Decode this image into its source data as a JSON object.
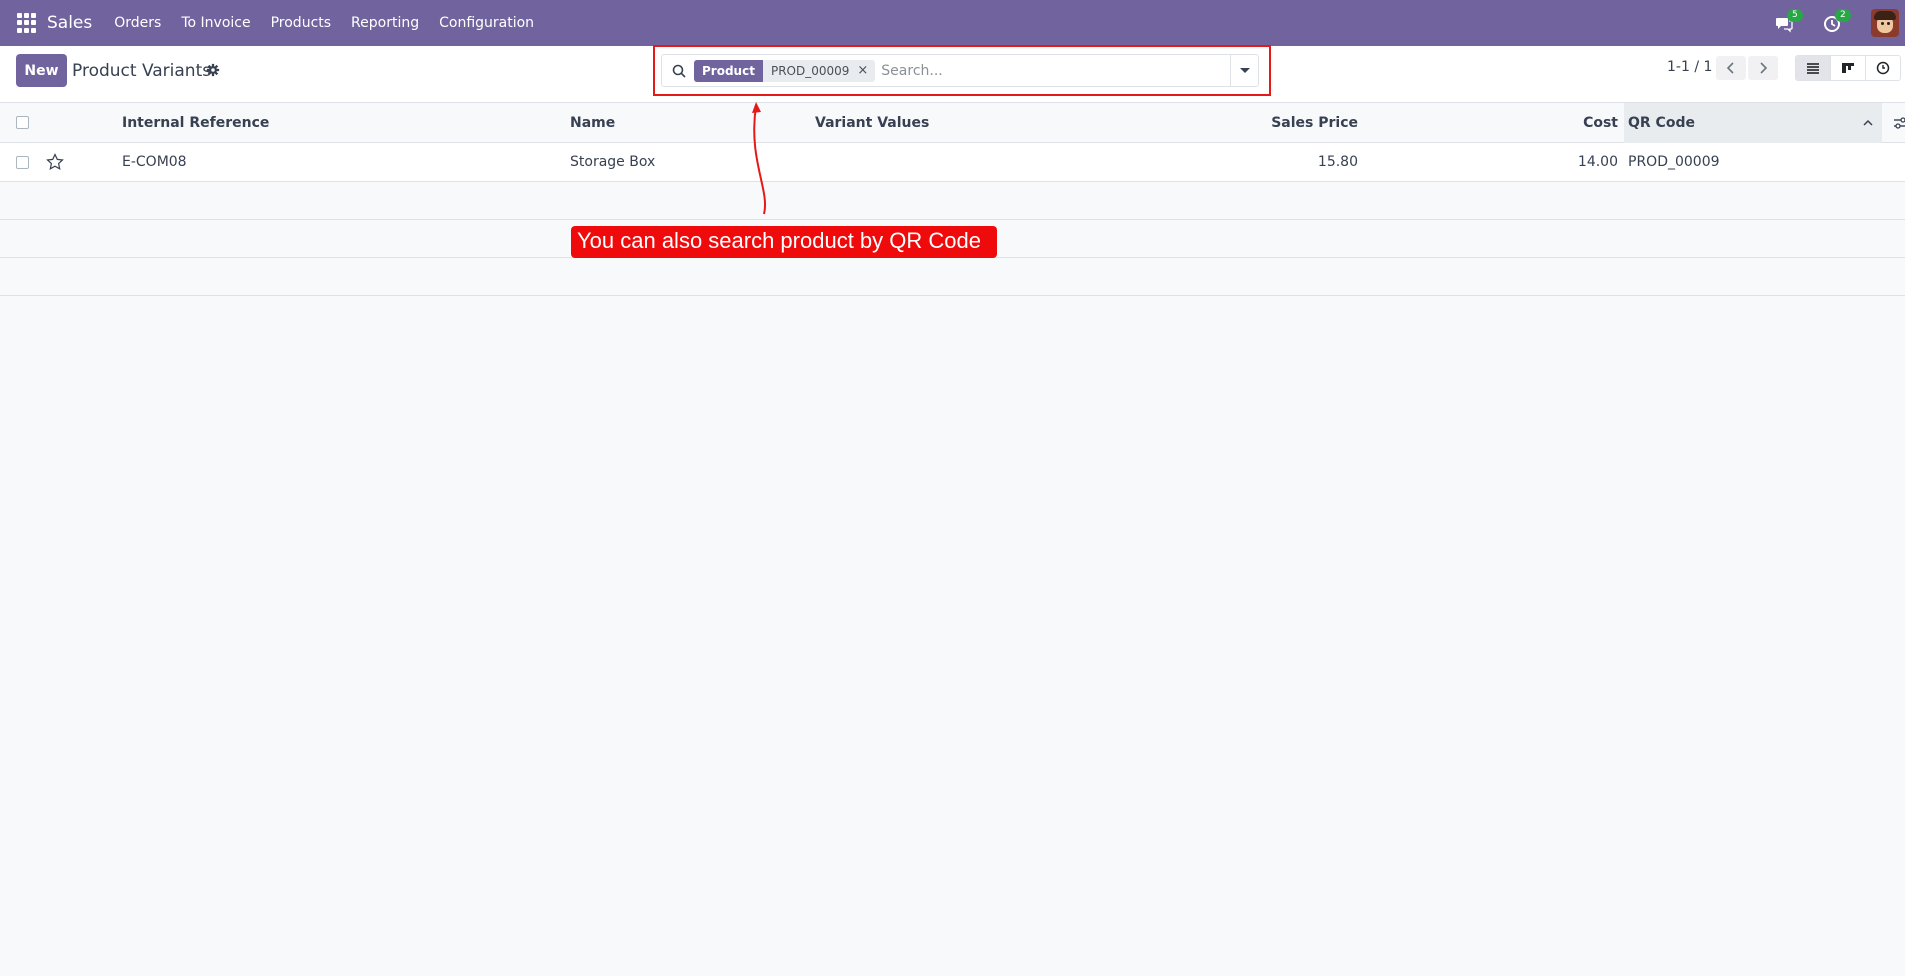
{
  "navbar": {
    "brand": "Sales",
    "menu": [
      {
        "label": "Orders"
      },
      {
        "label": "To Invoice"
      },
      {
        "label": "Products"
      },
      {
        "label": "Reporting"
      },
      {
        "label": "Configuration"
      }
    ],
    "messages_count": "5",
    "activities_count": "2",
    "background": "#71639e"
  },
  "control_panel": {
    "new_button": "New",
    "title": "Product Variants",
    "search": {
      "facet_label": "Product",
      "facet_value": "PROD_00009",
      "facet_remove": "×",
      "placeholder": "Search..."
    },
    "pager": "1-1 / 1"
  },
  "table": {
    "columns": {
      "internal_reference": "Internal Reference",
      "name": "Name",
      "variant_values": "Variant Values",
      "sales_price": "Sales Price",
      "cost": "Cost",
      "qr_code": "QR Code"
    },
    "rows": [
      {
        "internal_reference": "E-COM08",
        "name": "Storage Box",
        "variant_values": "",
        "sales_price": "15.80",
        "cost": "14.00",
        "qr_code": "PROD_00009"
      }
    ]
  },
  "annotation": {
    "text": "You can also search product by QR Code",
    "color": "#ef0b0b"
  }
}
